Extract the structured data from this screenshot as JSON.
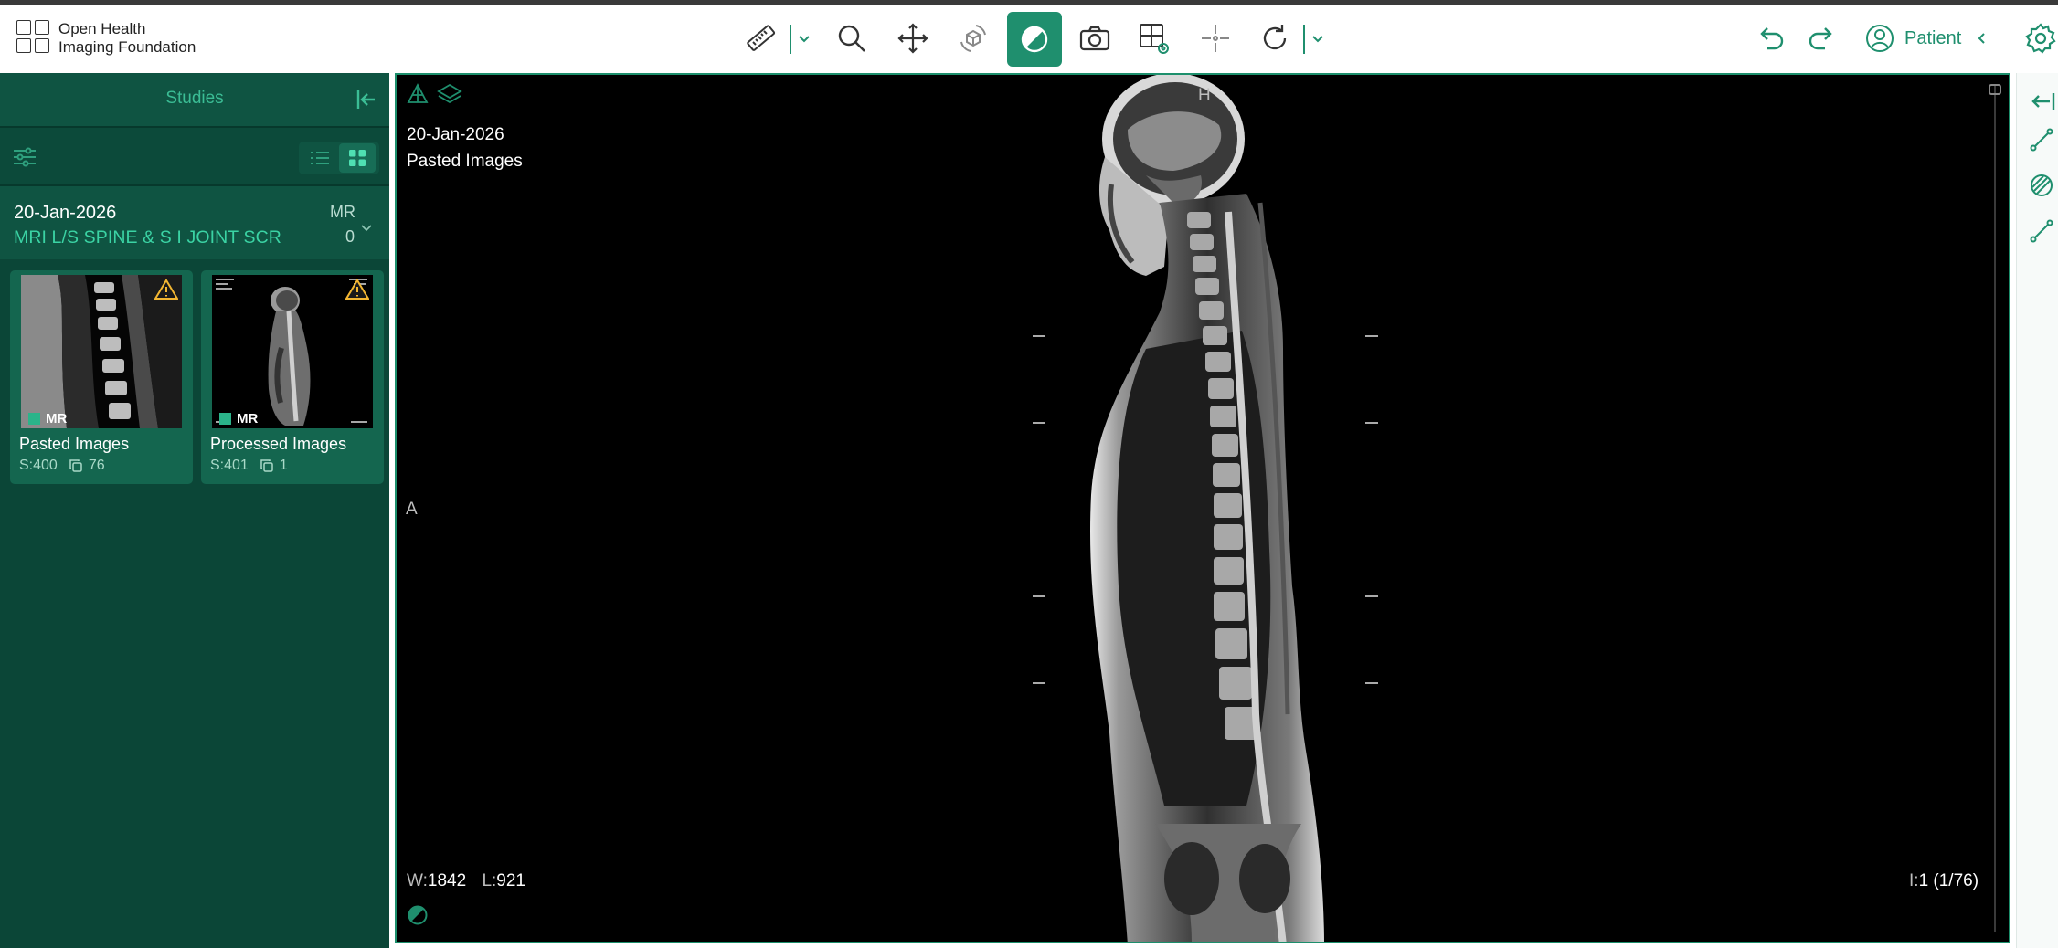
{
  "header": {
    "logo_line1": "Open Health",
    "logo_line2": "Imaging Foundation",
    "patient_label": "Patient"
  },
  "toolbar": {
    "tools": [
      "measure-ruler",
      "zoom",
      "pan",
      "rotate-3d",
      "window-level",
      "capture",
      "layout-settings",
      "crosshairs",
      "reset"
    ],
    "active_tool": "window-level"
  },
  "sidebar": {
    "title": "Studies",
    "study": {
      "date": "20-Jan-2026",
      "description": "MRI L/S SPINE & S I JOINT SCR",
      "modality": "MR",
      "count": "0"
    },
    "series": [
      {
        "modality": "MR",
        "title": "Pasted Images",
        "series_number": "S:400",
        "instances": "76"
      },
      {
        "modality": "MR",
        "title": "Processed Images",
        "series_number": "S:401",
        "instances": "1"
      }
    ]
  },
  "viewer": {
    "study_date": "20-Jan-2026",
    "series_desc": "Pasted Images",
    "orientation_top": "H",
    "orientation_left": "A",
    "ww_label": "W:",
    "ww_value": "1842",
    "wl_label": "L:",
    "wl_value": "921",
    "instance_label": "I:",
    "instance_value": "1 (1/76)"
  },
  "colors": {
    "accent": "#1f8f6e",
    "panel_bg": "#0b4637",
    "panel_header": "#0f5442",
    "thumb_bg": "#14664f",
    "study_desc": "#3bd3a4",
    "warning": "#f2b632"
  }
}
